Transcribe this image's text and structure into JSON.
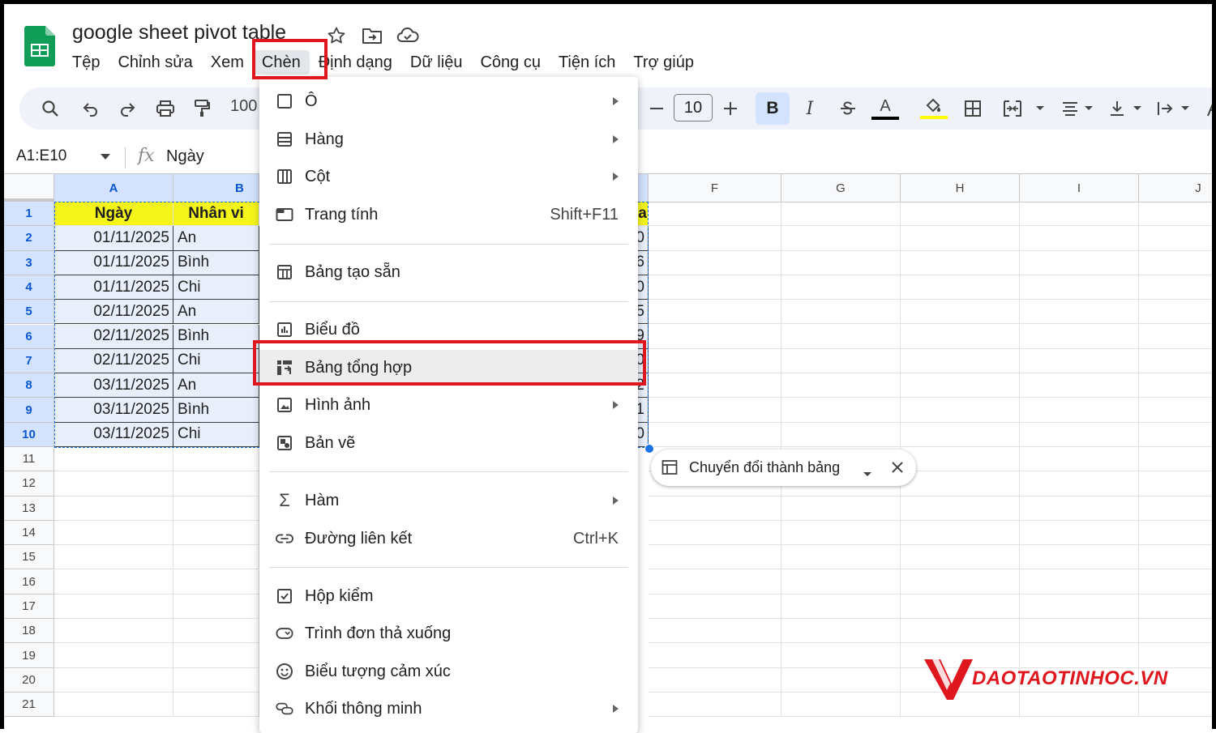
{
  "document": {
    "title": "google sheet pivot table"
  },
  "menubar": [
    "Tệp",
    "Chỉnh sửa",
    "Xem",
    "Chèn",
    "Định dạng",
    "Dữ liệu",
    "Công cụ",
    "Tiện ích",
    "Trợ giúp"
  ],
  "toolbar": {
    "zoom": "100",
    "font_size": "10",
    "bold": "B",
    "italic": "I",
    "text_color_letter": "A",
    "text_color": "#000000",
    "fill_color": "#ffff00"
  },
  "formula_bar": {
    "name_box": "A1:E10",
    "fx": "fx",
    "content": "Ngày"
  },
  "columns": [
    "A",
    "B",
    "F",
    "G",
    "H",
    "I",
    "J"
  ],
  "rows": [
    "1",
    "2",
    "3",
    "4",
    "5",
    "6",
    "7",
    "8",
    "9",
    "10",
    "11",
    "12",
    "13",
    "14",
    "15",
    "16",
    "17",
    "18",
    "19",
    "20",
    "21"
  ],
  "header_row": {
    "a": "Ngày",
    "b": "Nhân vi",
    "e_tail": "a"
  },
  "data_rows": [
    {
      "date": "01/11/2025",
      "name": "An",
      "tail": "0"
    },
    {
      "date": "01/11/2025",
      "name": "Bình",
      "tail": "6"
    },
    {
      "date": "01/11/2025",
      "name": "Chi",
      "tail": "0"
    },
    {
      "date": "02/11/2025",
      "name": "An",
      "tail": "5"
    },
    {
      "date": "02/11/2025",
      "name": "Bình",
      "tail": "9"
    },
    {
      "date": "02/11/2025",
      "name": "Chi",
      "tail": "0"
    },
    {
      "date": "03/11/2025",
      "name": "An",
      "tail": "2"
    },
    {
      "date": "03/11/2025",
      "name": "Bình",
      "tail": "1"
    },
    {
      "date": "03/11/2025",
      "name": "Chi",
      "tail": "0"
    }
  ],
  "chip": {
    "label": "Chuyển đổi thành bảng"
  },
  "insert_menu": {
    "o": "Ô",
    "hang": "Hàng",
    "cot": "Cột",
    "trang_tinh": "Trang tính",
    "trang_tinh_shortcut": "Shift+F11",
    "bang_tao_san": "Bảng tạo sẵn",
    "bieu_do": "Biểu đồ",
    "bang_tong_hop": "Bảng tổng hợp",
    "hinh_anh": "Hình ảnh",
    "ban_ve": "Bản vẽ",
    "ham": "Hàm",
    "duong_lien_ket": "Đường liên kết",
    "duong_lien_ket_shortcut": "Ctrl+K",
    "hop_kiem": "Hộp kiểm",
    "trinh_don": "Trình đơn thả xuống",
    "bieu_tuong": "Biểu tượng cảm xúc",
    "khoi_thong_minh": "Khối thông minh"
  },
  "watermark": {
    "text": "DAOTAOTINHOC.VN"
  },
  "colors": {
    "accent": "#1a73e8",
    "highlight_red": "#e0161e",
    "header_yellow": "#f5f51a",
    "sheets_green": "#0f9d58"
  }
}
